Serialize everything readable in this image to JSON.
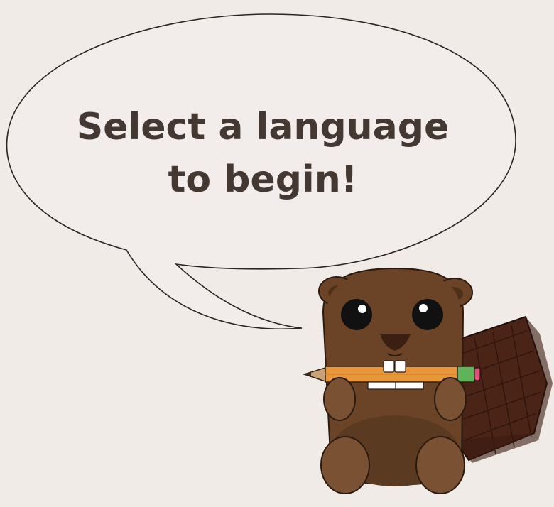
{
  "prompt": {
    "line1": "Select a language",
    "line2": "to begin!"
  },
  "mascot": {
    "icon": "beaver-with-pencil-icon"
  },
  "colors": {
    "background": "#f0ebe7",
    "text": "#433932",
    "beaver_body": "#6b4428",
    "beaver_belly": "#5a3a20",
    "tail": "#4b2418",
    "pencil": "#e8963a"
  }
}
